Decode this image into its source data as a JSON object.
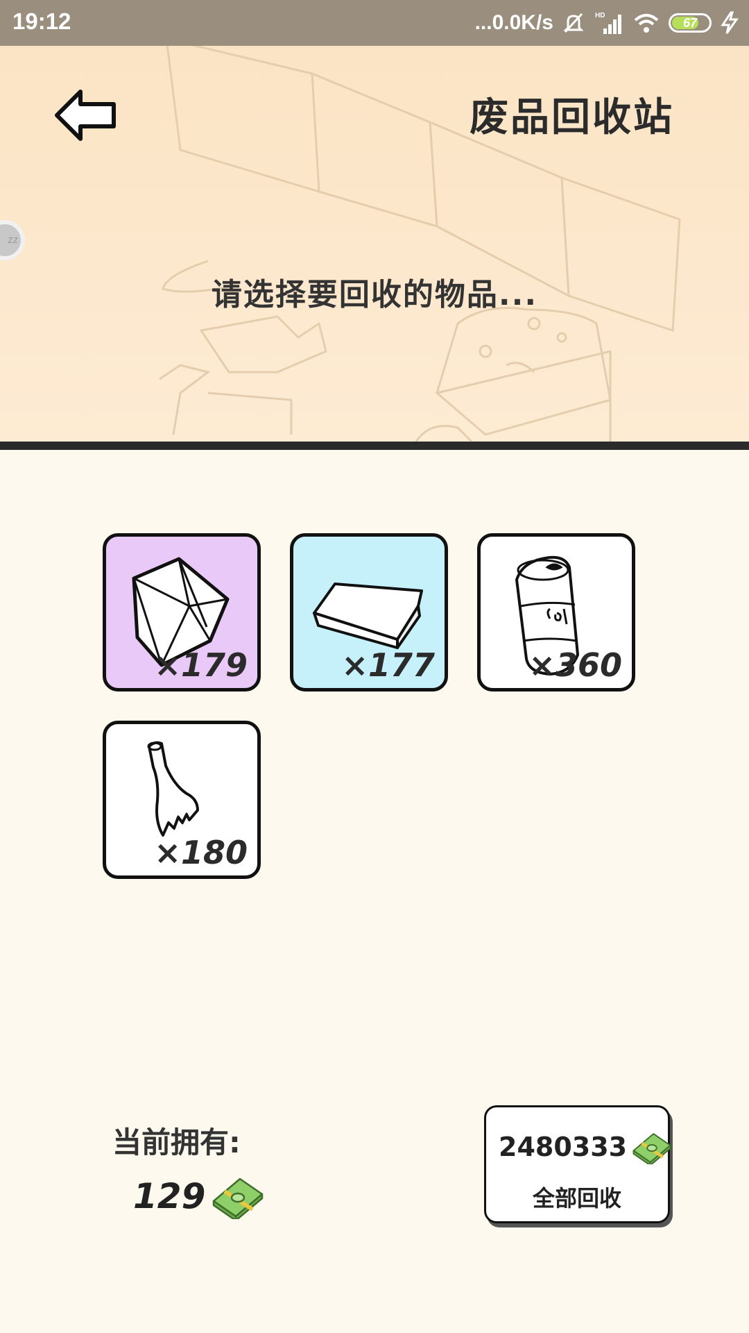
{
  "status_bar": {
    "time": "19:12",
    "network_speed": "...0.0K/s",
    "network_type": "HD",
    "battery_level": "67",
    "icons": [
      "mute-bell-icon",
      "signal-icon",
      "wifi-icon",
      "battery-icon",
      "charging-icon"
    ]
  },
  "header": {
    "title": "废品回收站",
    "prompt": "请选择要回收的物品...",
    "back_icon": "back-arrow-icon",
    "side_bubble_text": "zz"
  },
  "items": [
    {
      "name": "diamond",
      "icon": "diamond-icon",
      "count": "×179",
      "bg": "#e8c9f7"
    },
    {
      "name": "gold-bar",
      "icon": "metal-bar-icon",
      "count": "×177",
      "bg": "#c6f1fb"
    },
    {
      "name": "cola-can",
      "icon": "cola-can-icon",
      "count": "×360",
      "bg": "#ffffff"
    },
    {
      "name": "broken-bottle",
      "icon": "broken-bottle-icon",
      "count": "×180",
      "bg": "#ffffff"
    }
  ],
  "owned": {
    "label": "当前拥有:",
    "value": "129",
    "icon": "money-stack-icon"
  },
  "recycle_all": {
    "value": "2480333",
    "label": "全部回收",
    "icon": "money-stack-icon"
  },
  "colors": {
    "header_bg": "#fbe4c5",
    "page_bg": "#fdf9ef",
    "status_bar": "#9a8f7e",
    "money_green": "#8fcf6a"
  }
}
